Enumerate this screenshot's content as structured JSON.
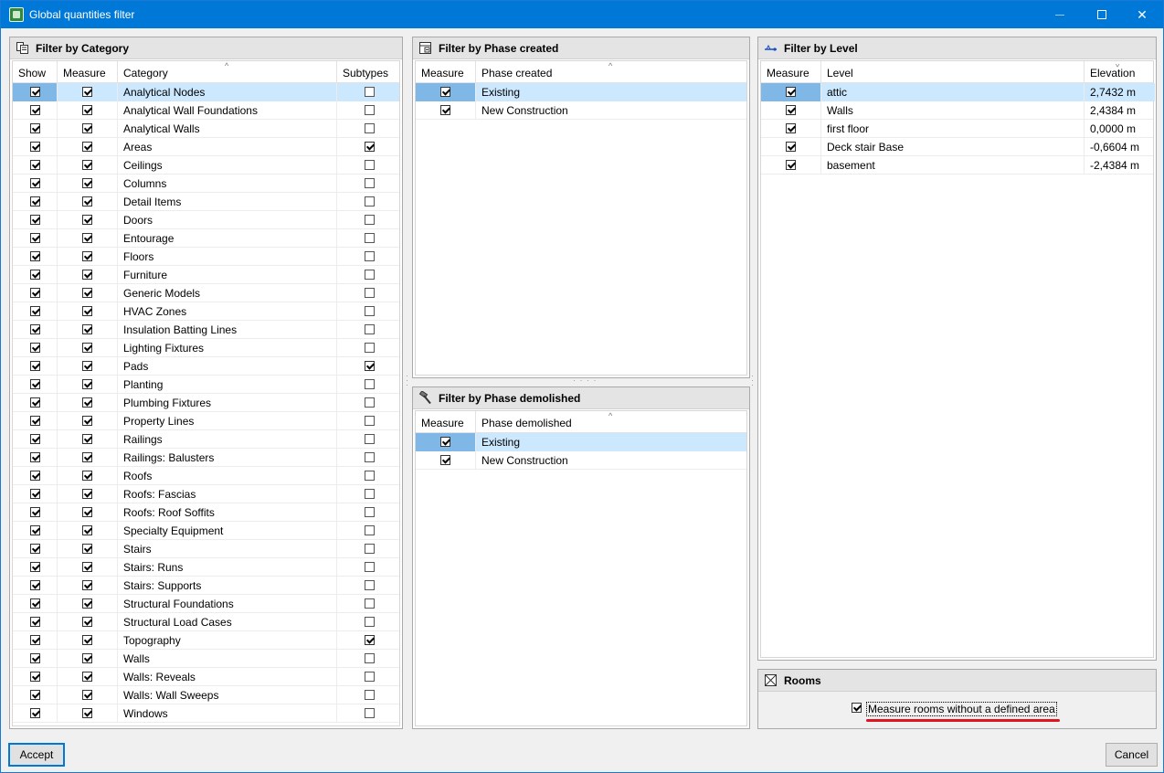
{
  "window": {
    "title": "Global quantities filter"
  },
  "category_panel": {
    "title": "Filter by Category",
    "columns": {
      "show": "Show",
      "measure": "Measure",
      "category": "Category",
      "subtypes": "Subtypes"
    },
    "rows": [
      {
        "name": "Analytical Nodes",
        "show": true,
        "measure": true,
        "subtypes": false
      },
      {
        "name": "Analytical Wall Foundations",
        "show": true,
        "measure": true,
        "subtypes": false
      },
      {
        "name": "Analytical Walls",
        "show": true,
        "measure": true,
        "subtypes": false
      },
      {
        "name": "Areas",
        "show": true,
        "measure": true,
        "subtypes": true
      },
      {
        "name": "Ceilings",
        "show": true,
        "measure": true,
        "subtypes": false
      },
      {
        "name": "Columns",
        "show": true,
        "measure": true,
        "subtypes": false
      },
      {
        "name": "Detail Items",
        "show": true,
        "measure": true,
        "subtypes": false
      },
      {
        "name": "Doors",
        "show": true,
        "measure": true,
        "subtypes": false
      },
      {
        "name": "Entourage",
        "show": true,
        "measure": true,
        "subtypes": false
      },
      {
        "name": "Floors",
        "show": true,
        "measure": true,
        "subtypes": false
      },
      {
        "name": "Furniture",
        "show": true,
        "measure": true,
        "subtypes": false
      },
      {
        "name": "Generic Models",
        "show": true,
        "measure": true,
        "subtypes": false
      },
      {
        "name": "HVAC Zones",
        "show": true,
        "measure": true,
        "subtypes": false
      },
      {
        "name": "Insulation Batting Lines",
        "show": true,
        "measure": true,
        "subtypes": false
      },
      {
        "name": "Lighting Fixtures",
        "show": true,
        "measure": true,
        "subtypes": false
      },
      {
        "name": "Pads",
        "show": true,
        "measure": true,
        "subtypes": true
      },
      {
        "name": "Planting",
        "show": true,
        "measure": true,
        "subtypes": false
      },
      {
        "name": "Plumbing Fixtures",
        "show": true,
        "measure": true,
        "subtypes": false
      },
      {
        "name": "Property Lines",
        "show": true,
        "measure": true,
        "subtypes": false
      },
      {
        "name": "Railings",
        "show": true,
        "measure": true,
        "subtypes": false
      },
      {
        "name": "Railings: Balusters",
        "show": true,
        "measure": true,
        "subtypes": false
      },
      {
        "name": "Roofs",
        "show": true,
        "measure": true,
        "subtypes": false
      },
      {
        "name": "Roofs: Fascias",
        "show": true,
        "measure": true,
        "subtypes": false
      },
      {
        "name": "Roofs: Roof Soffits",
        "show": true,
        "measure": true,
        "subtypes": false
      },
      {
        "name": "Specialty Equipment",
        "show": true,
        "measure": true,
        "subtypes": false
      },
      {
        "name": "Stairs",
        "show": true,
        "measure": true,
        "subtypes": false
      },
      {
        "name": "Stairs: Runs",
        "show": true,
        "measure": true,
        "subtypes": false
      },
      {
        "name": "Stairs: Supports",
        "show": true,
        "measure": true,
        "subtypes": false
      },
      {
        "name": "Structural Foundations",
        "show": true,
        "measure": true,
        "subtypes": false
      },
      {
        "name": "Structural Load Cases",
        "show": true,
        "measure": true,
        "subtypes": false
      },
      {
        "name": "Topography",
        "show": true,
        "measure": true,
        "subtypes": true
      },
      {
        "name": "Walls",
        "show": true,
        "measure": true,
        "subtypes": false
      },
      {
        "name": "Walls: Reveals",
        "show": true,
        "measure": true,
        "subtypes": false
      },
      {
        "name": "Walls: Wall Sweeps",
        "show": true,
        "measure": true,
        "subtypes": false
      },
      {
        "name": "Windows",
        "show": true,
        "measure": true,
        "subtypes": false
      }
    ]
  },
  "phase_created_panel": {
    "title": "Filter by Phase created",
    "columns": {
      "measure": "Measure",
      "phase": "Phase created"
    },
    "rows": [
      {
        "name": "Existing",
        "measure": true
      },
      {
        "name": "New Construction",
        "measure": true
      }
    ]
  },
  "phase_demolished_panel": {
    "title": "Filter by Phase demolished",
    "columns": {
      "measure": "Measure",
      "phase": "Phase demolished"
    },
    "rows": [
      {
        "name": "Existing",
        "measure": true
      },
      {
        "name": "New Construction",
        "measure": true
      }
    ]
  },
  "level_panel": {
    "title": "Filter by Level",
    "columns": {
      "measure": "Measure",
      "level": "Level",
      "elevation": "Elevation"
    },
    "rows": [
      {
        "name": "attic",
        "measure": true,
        "elevation": "2,7432 m"
      },
      {
        "name": "Walls",
        "measure": true,
        "elevation": "2,4384 m"
      },
      {
        "name": "first floor",
        "measure": true,
        "elevation": "0,0000 m"
      },
      {
        "name": "Deck stair Base",
        "measure": true,
        "elevation": "-0,6604 m"
      },
      {
        "name": "basement",
        "measure": true,
        "elevation": "-2,4384 m"
      }
    ]
  },
  "rooms_panel": {
    "title": "Rooms",
    "checkbox_label": "Measure rooms without a defined area",
    "checked": true
  },
  "footer": {
    "accept_label": "Accept",
    "cancel_label": "Cancel"
  },
  "colors": {
    "titlebar": "#0078d7",
    "selected_row": "#cce8ff",
    "selected_row_first_cell": "#7fb8e6",
    "annotation_underline": "#e0141e"
  }
}
